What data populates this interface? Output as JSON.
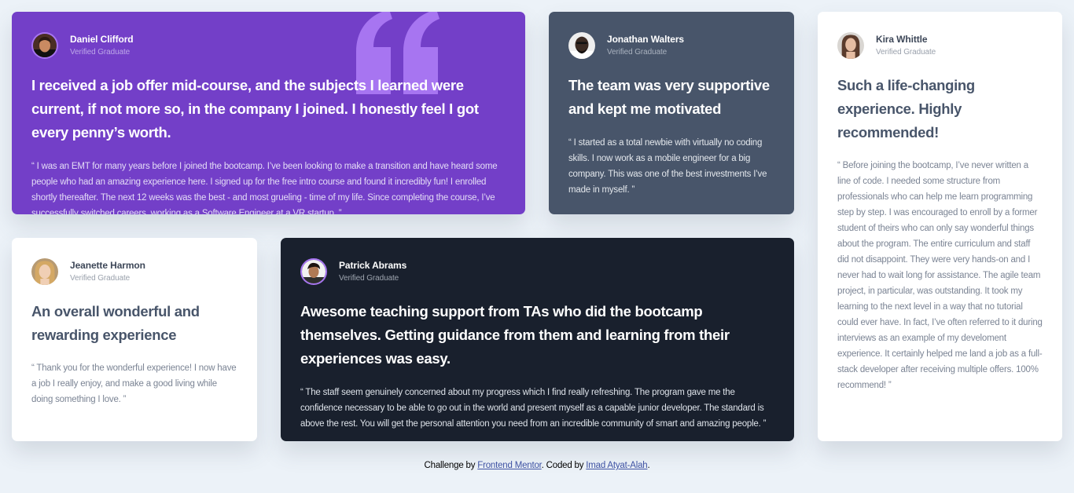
{
  "colors": {
    "page_background": "#ecf2f8",
    "moderate_violet": "#733fc8",
    "grayish_blue": "#48556a",
    "very_dark_blackish_blue": "#19202d",
    "white": "#ffffff",
    "link": "#3e52a3"
  },
  "testimonials": [
    {
      "name": "Daniel Clifford",
      "role": "Verified Graduate",
      "avatar_icon": "daniel-avatar",
      "headline": "I received a job offer mid-course, and the subjects I learned were current, if not more so, in the company I joined. I honestly feel I got every penny’s worth.",
      "quote": "“ I was an EMT for many years before I joined the bootcamp. I’ve been looking to make a transition and have heard some people who had an amazing experience here. I signed up for the free intro course and found it incredibly fun! I enrolled shortly thereafter. The next 12 weeks was the best - and most grueling - time of my life. Since completing the course, I’ve successfully switched careers, working as a Software Engineer at a VR startup. ”"
    },
    {
      "name": "Jonathan Walters",
      "role": "Verified Graduate",
      "avatar_icon": "jonathan-avatar",
      "headline": "The team was very supportive and kept me motivated",
      "quote": "“ I started as a total newbie with virtually no coding skills. I now work as a mobile engineer for a big company. This was one of the best investments I’ve made in myself. ”"
    },
    {
      "name": "Kira Whittle",
      "role": "Verified Graduate",
      "avatar_icon": "kira-avatar",
      "headline": "Such a life-changing experience. Highly recommended!",
      "quote": "“ Before joining the bootcamp, I’ve never written a line of code. I needed some structure from professionals who can help me learn programming step by step. I was encouraged to enroll by a former student of theirs who can only say wonderful things about the program. The entire curriculum and staff did not disappoint. They were very hands-on and I never had to wait long for assistance. The agile team project, in particular, was outstanding. It took my learning to the next level in a way that no tutorial could ever have. In fact, I’ve often referred to it during interviews as an example of my develoment experience. It certainly helped me land a job as a full-stack developer after receiving multiple offers. 100% recommend! ”"
    },
    {
      "name": "Jeanette Harmon",
      "role": "Verified Graduate",
      "avatar_icon": "jeanette-avatar",
      "headline": "An overall wonderful and rewarding experience",
      "quote": "“ Thank you for the wonderful experience! I now have a job I really enjoy, and make a good living while doing something I love. ”"
    },
    {
      "name": "Patrick Abrams",
      "role": "Verified Graduate",
      "avatar_icon": "patrick-avatar",
      "headline": "Awesome teaching support from TAs who did the bootcamp themselves. Getting guidance from them and learning from their experiences was easy.",
      "quote": "“ The staff seem genuinely concerned about my progress which I find really refreshing. The program gave me the confidence necessary to be able to go out in the world and present myself as a capable junior developer. The standard is above the rest. You will get the personal attention you need from an incredible community of smart and amazing people. ”"
    }
  ],
  "attribution": {
    "prefix": "Challenge by ",
    "challenge_link": "Frontend Mentor",
    "middle": ". Coded by ",
    "author_link": "Imad Atyat-Alah",
    "suffix": "."
  }
}
